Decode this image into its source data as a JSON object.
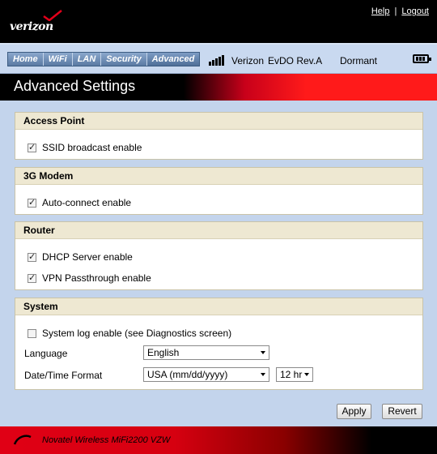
{
  "brand": {
    "logo_text": "verizon"
  },
  "top_links": {
    "help": "Help",
    "separator": "|",
    "logout": "Logout"
  },
  "nav": {
    "tabs": [
      {
        "label": "Home"
      },
      {
        "label": "WiFi"
      },
      {
        "label": "LAN"
      },
      {
        "label": "Security"
      },
      {
        "label": "Advanced"
      }
    ],
    "active_tab": "Advanced"
  },
  "status": {
    "carrier": "Verizon",
    "network": "EvDO Rev.A",
    "state": "Dormant",
    "signal_bars": 5
  },
  "page": {
    "title": "Advanced Settings"
  },
  "sections": {
    "access_point": {
      "title": "Access Point",
      "ssid_broadcast": {
        "label": "SSID broadcast enable",
        "checked": true
      }
    },
    "modem": {
      "title": "3G Modem",
      "auto_connect": {
        "label": "Auto-connect enable",
        "checked": true
      }
    },
    "router": {
      "title": "Router",
      "dhcp": {
        "label": "DHCP Server enable",
        "checked": true
      },
      "vpn": {
        "label": "VPN Passthrough enable",
        "checked": true
      }
    },
    "system": {
      "title": "System",
      "syslog": {
        "label": "System log enable (see Diagnostics screen)",
        "checked": false
      },
      "language": {
        "label": "Language",
        "value": "English"
      },
      "datetime": {
        "label": "Date/Time Format",
        "date_value": "USA (mm/dd/yyyy)",
        "time_value": "12 hr"
      }
    }
  },
  "buttons": {
    "apply": "Apply",
    "revert": "Revert"
  },
  "footer": {
    "text": "Novatel Wireless MiFi2200 VZW"
  },
  "colors": {
    "accent_red": "#ff1a1a",
    "nav_blue": "#5a7aa3",
    "content_bg": "#c3d4ec",
    "section_header_bg": "#eee8d2"
  }
}
